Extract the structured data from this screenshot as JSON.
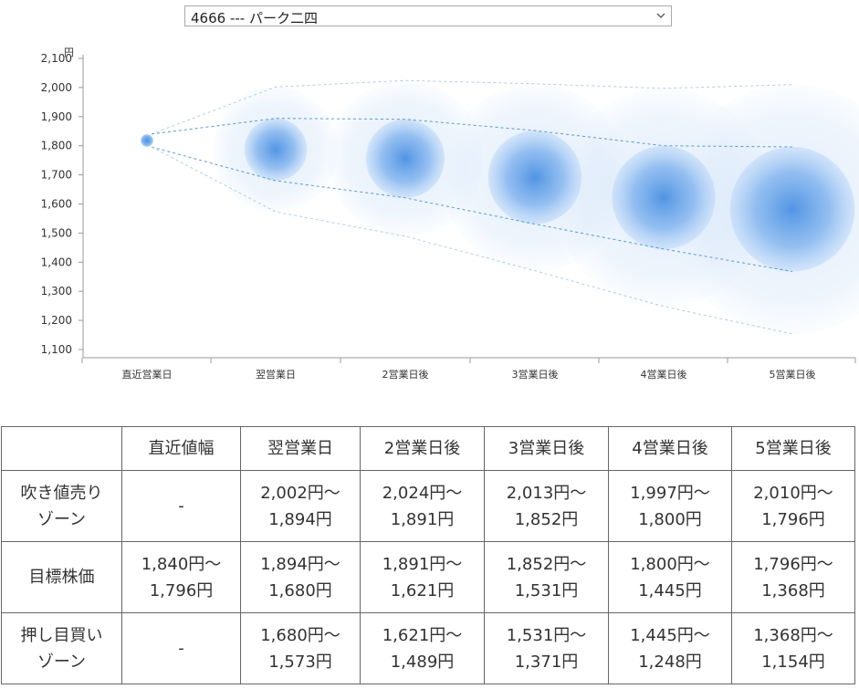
{
  "selector": {
    "selected": "4666 --- パーク二四"
  },
  "chart_data": {
    "type": "bubble-forecast",
    "y_unit": "円",
    "ylim": [
      1100,
      2100
    ],
    "yticks": [
      "2,100",
      "2,000",
      "1,900",
      "1,800",
      "1,700",
      "1,600",
      "1,500",
      "1,400",
      "1,300",
      "1,200",
      "1,100"
    ],
    "ytick_values": [
      2100,
      2000,
      1900,
      1800,
      1700,
      1600,
      1500,
      1400,
      1300,
      1200,
      1100
    ],
    "categories": [
      "直近営業日",
      "翌営業日",
      "2営業日後",
      "3営業日後",
      "4営業日後",
      "5営業日後"
    ],
    "center": [
      1818,
      1787,
      1756,
      1691,
      1622,
      1582
    ],
    "sell_zone_upper": [
      1840,
      2002,
      2024,
      2013,
      1997,
      2010
    ],
    "target_upper": [
      1840,
      1894,
      1891,
      1852,
      1800,
      1796
    ],
    "target_lower": [
      1796,
      1680,
      1621,
      1531,
      1445,
      1368
    ],
    "buy_zone_lower": [
      1796,
      1573,
      1489,
      1371,
      1248,
      1154
    ],
    "colors": {
      "inner": "#4a90e2",
      "outer": "#c6ddf7",
      "line": "#4a8fc8",
      "axis": "#999999"
    }
  },
  "table": {
    "headers": [
      "",
      "直近値幅",
      "翌営業日",
      "2営業日後",
      "3営業日後",
      "4営業日後",
      "5営業日後"
    ],
    "rows": [
      {
        "label_lines": [
          "吹き値売り",
          "ゾーン"
        ],
        "cells": [
          [
            "-"
          ],
          [
            "2,002円～",
            "1,894円"
          ],
          [
            "2,024円～",
            "1,891円"
          ],
          [
            "2,013円～",
            "1,852円"
          ],
          [
            "1,997円～",
            "1,800円"
          ],
          [
            "2,010円～",
            "1,796円"
          ]
        ]
      },
      {
        "label_lines": [
          "目標株価"
        ],
        "cells": [
          [
            "1,840円～",
            "1,796円"
          ],
          [
            "1,894円～",
            "1,680円"
          ],
          [
            "1,891円～",
            "1,621円"
          ],
          [
            "1,852円～",
            "1,531円"
          ],
          [
            "1,800円～",
            "1,445円"
          ],
          [
            "1,796円～",
            "1,368円"
          ]
        ]
      },
      {
        "label_lines": [
          "押し目買い",
          "ゾーン"
        ],
        "cells": [
          [
            "-"
          ],
          [
            "1,680円～",
            "1,573円"
          ],
          [
            "1,621円～",
            "1,489円"
          ],
          [
            "1,531円～",
            "1,371円"
          ],
          [
            "1,445円～",
            "1,248円"
          ],
          [
            "1,368円～",
            "1,154円"
          ]
        ]
      }
    ]
  }
}
